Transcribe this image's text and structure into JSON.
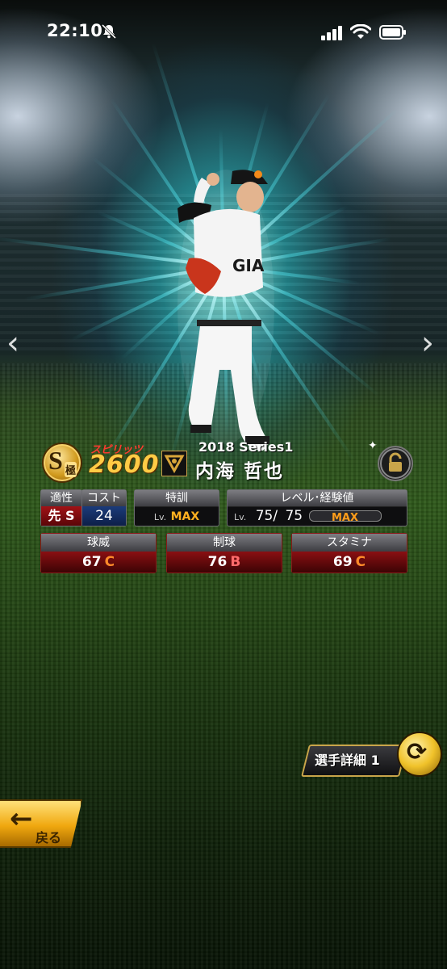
{
  "status_bar": {
    "time": "22:10"
  },
  "card": {
    "rarity": "S",
    "rarity_sub": "極",
    "spirits_label": "スピリッツ",
    "spirits_value": "2600",
    "series": "2018 Series1",
    "player_name": "内海 哲也"
  },
  "panels": {
    "aptitude": {
      "header": "適性",
      "position": "先",
      "grade": "S"
    },
    "cost": {
      "header": "コスト",
      "value": "24"
    },
    "training": {
      "header": "特訓",
      "lv_prefix": "Lv.",
      "value": "MAX"
    },
    "level": {
      "header": "レベル･経験値",
      "lv_prefix": "Lv.",
      "current": "75/",
      "max": "75",
      "exp_label": "MAX"
    }
  },
  "stats": [
    {
      "header": "球威",
      "value": "67",
      "rank": "C"
    },
    {
      "header": "制球",
      "value": "76",
      "rank": "B"
    },
    {
      "header": "スタミナ",
      "value": "69",
      "rank": "C"
    }
  ],
  "buttons": {
    "detail": "選手詳細 1",
    "back": "戻る"
  },
  "icons": {
    "nav_left": "‹",
    "nav_right": "›",
    "back_arrow": "←",
    "swap": "⟳"
  },
  "colors": {
    "accent_gold": "#ffcb45",
    "stat_red": "#8a0f12",
    "rank_c": "#ff8a2a",
    "rank_b": "#ff6b6b",
    "max_orange": "#ffb020"
  }
}
